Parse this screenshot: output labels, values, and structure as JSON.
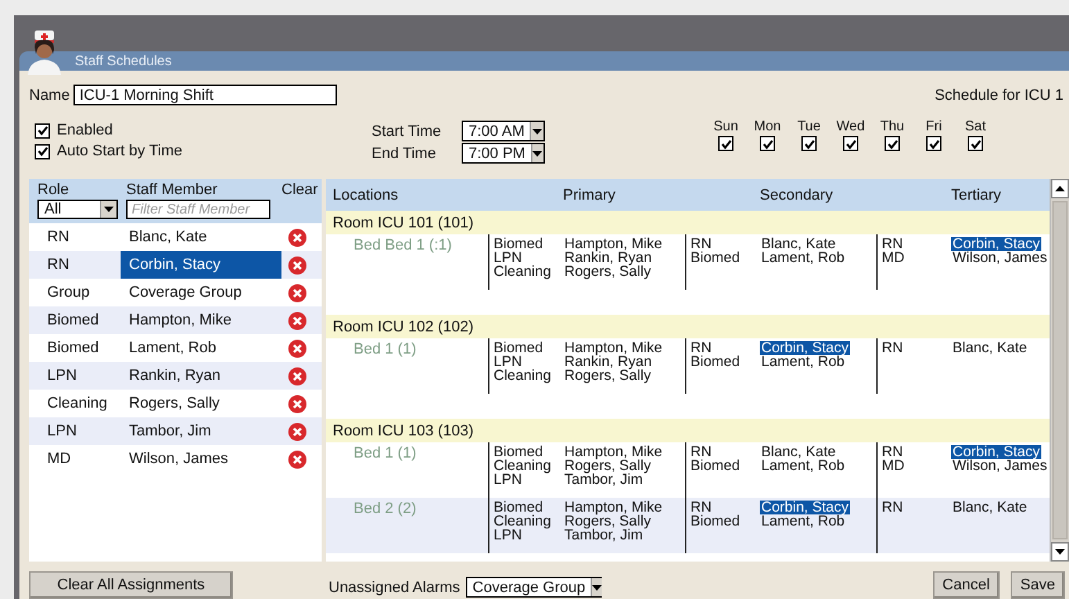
{
  "window": {
    "title": "Staff Schedules"
  },
  "name_field": {
    "label": "Name",
    "value": "ICU-1 Morning Shift"
  },
  "schedule_for": "Schedule for ICU 1",
  "options": [
    {
      "label": "Enabled",
      "checked": true
    },
    {
      "label": "Auto Start by Time",
      "checked": true
    }
  ],
  "times": [
    {
      "label": "Start Time",
      "value": "7:00 AM"
    },
    {
      "label": "End Time",
      "value": "7:00 PM"
    }
  ],
  "days": [
    {
      "label": "Sun",
      "checked": true
    },
    {
      "label": "Mon",
      "checked": true
    },
    {
      "label": "Tue",
      "checked": true
    },
    {
      "label": "Wed",
      "checked": true
    },
    {
      "label": "Thu",
      "checked": true
    },
    {
      "label": "Fri",
      "checked": true
    },
    {
      "label": "Sat",
      "checked": true
    }
  ],
  "staff_table": {
    "columns": [
      "Role",
      "Staff Member",
      "Clear"
    ],
    "role_filter": "All",
    "staff_filter": {
      "placeholder": "Filter Staff Member"
    },
    "rows": [
      {
        "role": "RN",
        "name": "Blanc, Kate",
        "selected": false
      },
      {
        "role": "RN",
        "name": "Corbin, Stacy",
        "selected": true
      },
      {
        "role": "Group",
        "name": "Coverage Group",
        "selected": false
      },
      {
        "role": "Biomed",
        "name": "Hampton, Mike",
        "selected": false
      },
      {
        "role": "Biomed",
        "name": "Lament, Rob",
        "selected": false
      },
      {
        "role": "LPN",
        "name": "Rankin, Ryan",
        "selected": false
      },
      {
        "role": "Cleaning",
        "name": "Rogers, Sally",
        "selected": false
      },
      {
        "role": "LPN",
        "name": "Tambor, Jim",
        "selected": false
      },
      {
        "role": "MD",
        "name": "Wilson, James",
        "selected": false
      }
    ]
  },
  "locations_table": {
    "columns": [
      "Locations",
      "Primary",
      "Secondary",
      "Tertiary"
    ],
    "rooms": [
      {
        "name": "Room ICU 101 (101)",
        "beds": [
          {
            "name": "Bed Bed 1 (:1)",
            "tiers": [
              [
                {
                  "role": "Biomed",
                  "name": "Hampton, Mike",
                  "selected": false
                },
                {
                  "role": "LPN",
                  "name": "Rankin, Ryan",
                  "selected": false
                },
                {
                  "role": "Cleaning",
                  "name": "Rogers, Sally",
                  "selected": false
                }
              ],
              [
                {
                  "role": "RN",
                  "name": "Blanc, Kate",
                  "selected": false
                },
                {
                  "role": "Biomed",
                  "name": "Lament, Rob",
                  "selected": false
                }
              ],
              [
                {
                  "role": "RN",
                  "name": "Corbin, Stacy",
                  "selected": true
                },
                {
                  "role": "MD",
                  "name": "Wilson, James",
                  "selected": false
                }
              ]
            ]
          }
        ]
      },
      {
        "name": "Room ICU 102 (102)",
        "beds": [
          {
            "name": "Bed 1 (1)",
            "tiers": [
              [
                {
                  "role": "Biomed",
                  "name": "Hampton, Mike",
                  "selected": false
                },
                {
                  "role": "LPN",
                  "name": "Rankin, Ryan",
                  "selected": false
                },
                {
                  "role": "Cleaning",
                  "name": "Rogers, Sally",
                  "selected": false
                }
              ],
              [
                {
                  "role": "RN",
                  "name": "Corbin, Stacy",
                  "selected": true
                },
                {
                  "role": "Biomed",
                  "name": "Lament, Rob",
                  "selected": false
                }
              ],
              [
                {
                  "role": "RN",
                  "name": "Blanc, Kate",
                  "selected": false
                }
              ]
            ]
          }
        ]
      },
      {
        "name": "Room ICU 103 (103)",
        "beds": [
          {
            "name": "Bed 1 (1)",
            "tiers": [
              [
                {
                  "role": "Biomed",
                  "name": "Hampton, Mike",
                  "selected": false
                },
                {
                  "role": "Cleaning",
                  "name": "Rogers, Sally",
                  "selected": false
                },
                {
                  "role": "LPN",
                  "name": "Tambor, Jim",
                  "selected": false
                }
              ],
              [
                {
                  "role": "RN",
                  "name": "Blanc, Kate",
                  "selected": false
                },
                {
                  "role": "Biomed",
                  "name": "Lament, Rob",
                  "selected": false
                }
              ],
              [
                {
                  "role": "RN",
                  "name": "Corbin, Stacy",
                  "selected": true
                },
                {
                  "role": "MD",
                  "name": "Wilson, James",
                  "selected": false
                }
              ]
            ]
          },
          {
            "name": "Bed 2 (2)",
            "tiers": [
              [
                {
                  "role": "Biomed",
                  "name": "Hampton, Mike",
                  "selected": false
                },
                {
                  "role": "Cleaning",
                  "name": "Rogers, Sally",
                  "selected": false
                },
                {
                  "role": "LPN",
                  "name": "Tambor, Jim",
                  "selected": false
                }
              ],
              [
                {
                  "role": "RN",
                  "name": "Corbin, Stacy",
                  "selected": true
                },
                {
                  "role": "Biomed",
                  "name": "Lament, Rob",
                  "selected": false
                }
              ],
              [
                {
                  "role": "RN",
                  "name": "Blanc, Kate",
                  "selected": false
                }
              ]
            ]
          }
        ]
      }
    ]
  },
  "clear_all_button": "Clear All Assignments",
  "unassigned_alarms": {
    "label": "Unassigned Alarms",
    "value": "Coverage Group"
  },
  "buttons": [
    "Cancel",
    "Save"
  ]
}
